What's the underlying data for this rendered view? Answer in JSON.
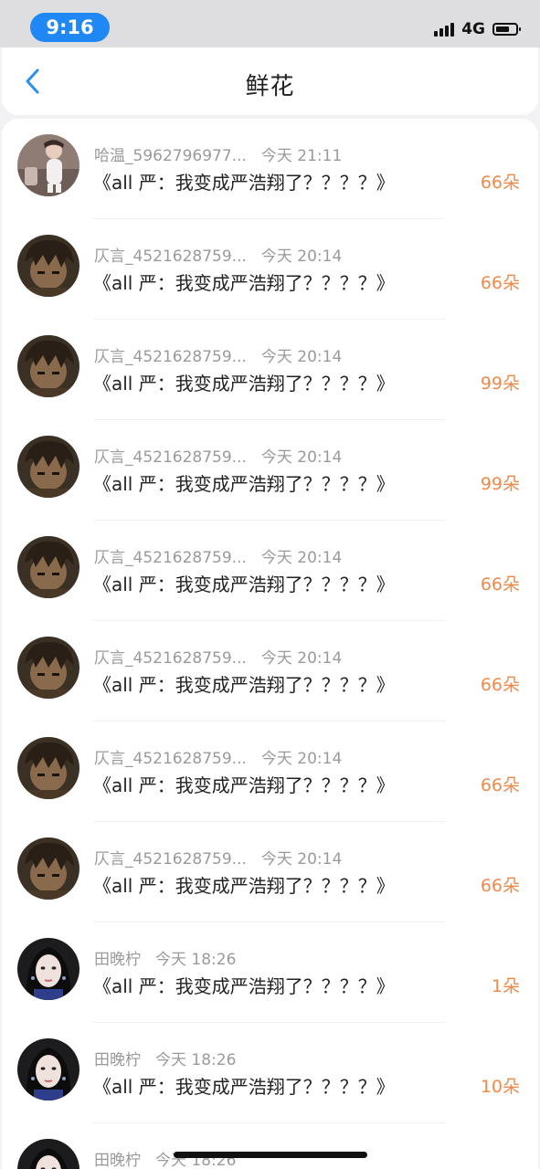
{
  "status": {
    "time": "9:16",
    "network": "4G"
  },
  "header": {
    "title": "鲜花"
  },
  "items": [
    {
      "user": "哈温_5962796977...",
      "date": "今天 21:11",
      "title": "《all 严：我变成严浩翔了？？？？》",
      "amount": "66朵",
      "avatar": "baby"
    },
    {
      "user": "仄言_4521628759...",
      "date": "今天 20:14",
      "title": "《all 严：我变成严浩翔了？？？？》",
      "amount": "66朵",
      "avatar": "anime"
    },
    {
      "user": "仄言_4521628759...",
      "date": "今天 20:14",
      "title": "《all 严：我变成严浩翔了？？？？》",
      "amount": "99朵",
      "avatar": "anime"
    },
    {
      "user": "仄言_4521628759...",
      "date": "今天 20:14",
      "title": "《all 严：我变成严浩翔了？？？？》",
      "amount": "99朵",
      "avatar": "anime"
    },
    {
      "user": "仄言_4521628759...",
      "date": "今天 20:14",
      "title": "《all 严：我变成严浩翔了？？？？》",
      "amount": "66朵",
      "avatar": "anime"
    },
    {
      "user": "仄言_4521628759...",
      "date": "今天 20:14",
      "title": "《all 严：我变成严浩翔了？？？？》",
      "amount": "66朵",
      "avatar": "anime"
    },
    {
      "user": "仄言_4521628759...",
      "date": "今天 20:14",
      "title": "《all 严：我变成严浩翔了？？？？》",
      "amount": "66朵",
      "avatar": "anime"
    },
    {
      "user": "仄言_4521628759...",
      "date": "今天 20:14",
      "title": "《all 严：我变成严浩翔了？？？？》",
      "amount": "66朵",
      "avatar": "anime"
    },
    {
      "user": "田晚柠",
      "date": "今天 18:26",
      "title": "《all 严：我变成严浩翔了？？？？》",
      "amount": "1朵",
      "avatar": "girl"
    },
    {
      "user": "田晚柠",
      "date": "今天 18:26",
      "title": "《all 严：我变成严浩翔了？？？？》",
      "amount": "10朵",
      "avatar": "girl"
    },
    {
      "user": "田晚柠",
      "date": "今天 18:26",
      "title": "",
      "amount": "",
      "avatar": "girl"
    }
  ]
}
